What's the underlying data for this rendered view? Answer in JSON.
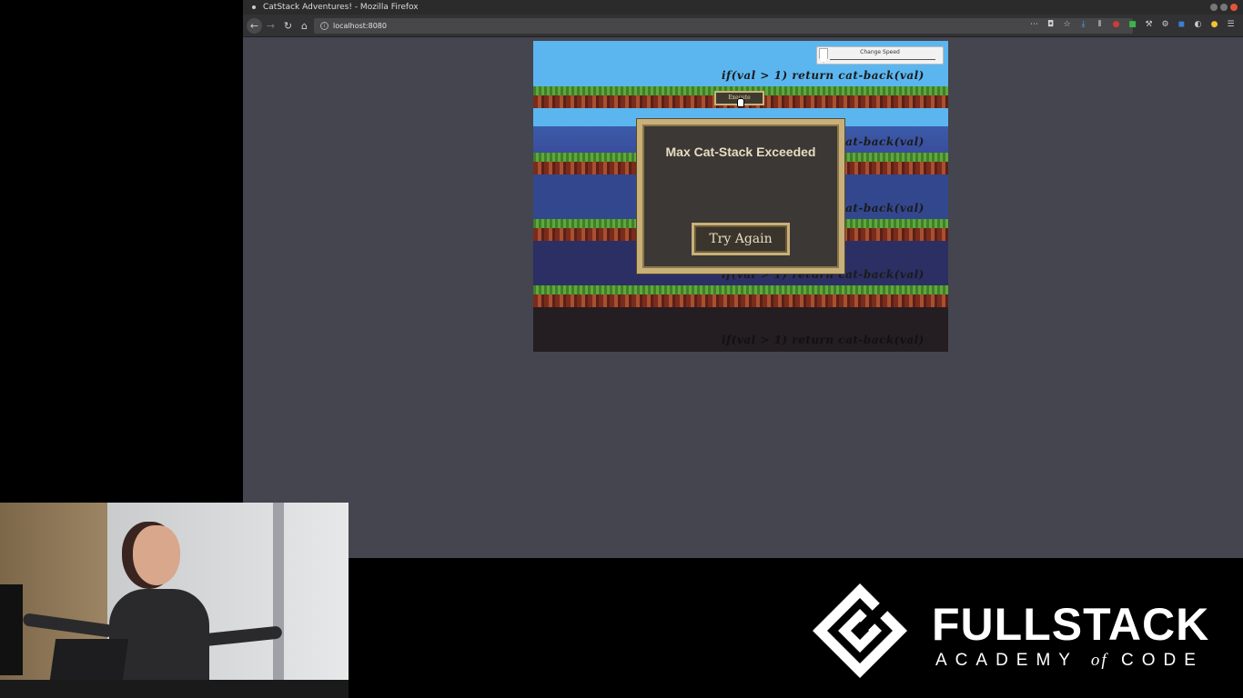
{
  "browser": {
    "window_title": "CatStack Adventures! - Mozilla Firefox",
    "url": "localhost:8080",
    "nav": {
      "back_glyph": "←",
      "forward_glyph": "→",
      "reload_glyph": "↻",
      "home_glyph": "⌂"
    },
    "toolbar_icons": [
      "more-icon",
      "pocket-icon",
      "bookmark-star-icon",
      "download-icon",
      "library-icon",
      "ublock-icon",
      "extension-green-icon",
      "tools-icon",
      "settings-icon",
      "extension-blue-icon",
      "extension-gray-icon",
      "emoji-icon",
      "menu-icon"
    ]
  },
  "game": {
    "speed_control_label": "Change Speed",
    "execute_label": "Execute",
    "code_lines": [
      "if(val > 1) return cat-back(val)",
      "if(val > 1) return cat-back(val)",
      "if(val > 1) return cat-back(val)",
      "if(val > 1) return cat-back(val)",
      "if(val > 1) return cat-back(val)"
    ],
    "modal": {
      "title": "Max Cat-Stack Exceeded",
      "button_label": "Try Again"
    }
  },
  "branding": {
    "title": "FULLSTACK",
    "subtitle_pre": "ACADEMY",
    "subtitle_of": "of",
    "subtitle_post": "CODE"
  },
  "colors": {
    "modal_border": "#c8b07a",
    "modal_bg": "#3b3835",
    "sky": "#5bb6ef",
    "page_bg": "#44454e"
  }
}
